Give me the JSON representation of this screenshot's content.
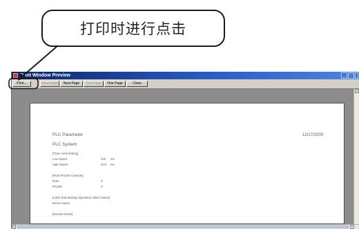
{
  "callout": {
    "text": "打印时进行点击"
  },
  "window": {
    "title": "Print Window Preview",
    "buttons": {
      "min": "_",
      "max": "□",
      "close": "×"
    }
  },
  "toolbar": {
    "print": "Print...",
    "prev_page": "Prev Page",
    "next_page": "Next Page",
    "two_page": "Two Page",
    "one_page": "One Page",
    "close": "Close"
  },
  "document": {
    "title": "PLC Parameter",
    "date": "12/17/2009",
    "section": "PLC System",
    "lines": [
      {
        "label": "[Timer Limit Setting]",
        "value": "",
        "unit": ""
      },
      {
        "label": "Low Speed",
        "value": "100",
        "unit": "ms"
      },
      {
        "label": "High Speed",
        "value": "10.0",
        "unit": "ms"
      },
      {
        "label": "",
        "value": "",
        "unit": ""
      },
      {
        "label": "[RUN-PAUSE Contacts]",
        "value": "",
        "unit": ""
      },
      {
        "label": "RUN",
        "value": "X",
        "unit": ""
      },
      {
        "label": "PAUSE",
        "value": "X",
        "unit": ""
      },
      {
        "label": "",
        "value": "",
        "unit": ""
      },
      {
        "label": "[Latch Data Backup Operation Valid Contact]",
        "value": "",
        "unit": ""
      },
      {
        "label": "Device Name",
        "value": "-",
        "unit": "-"
      },
      {
        "label": "",
        "value": "",
        "unit": ""
      },
      {
        "label": "[Remote Reset]",
        "value": "",
        "unit": ""
      }
    ]
  },
  "colors": {
    "titlebar": "#0a246a",
    "workspace": "#8c8c8c",
    "highlight": "#1a1a1a"
  }
}
